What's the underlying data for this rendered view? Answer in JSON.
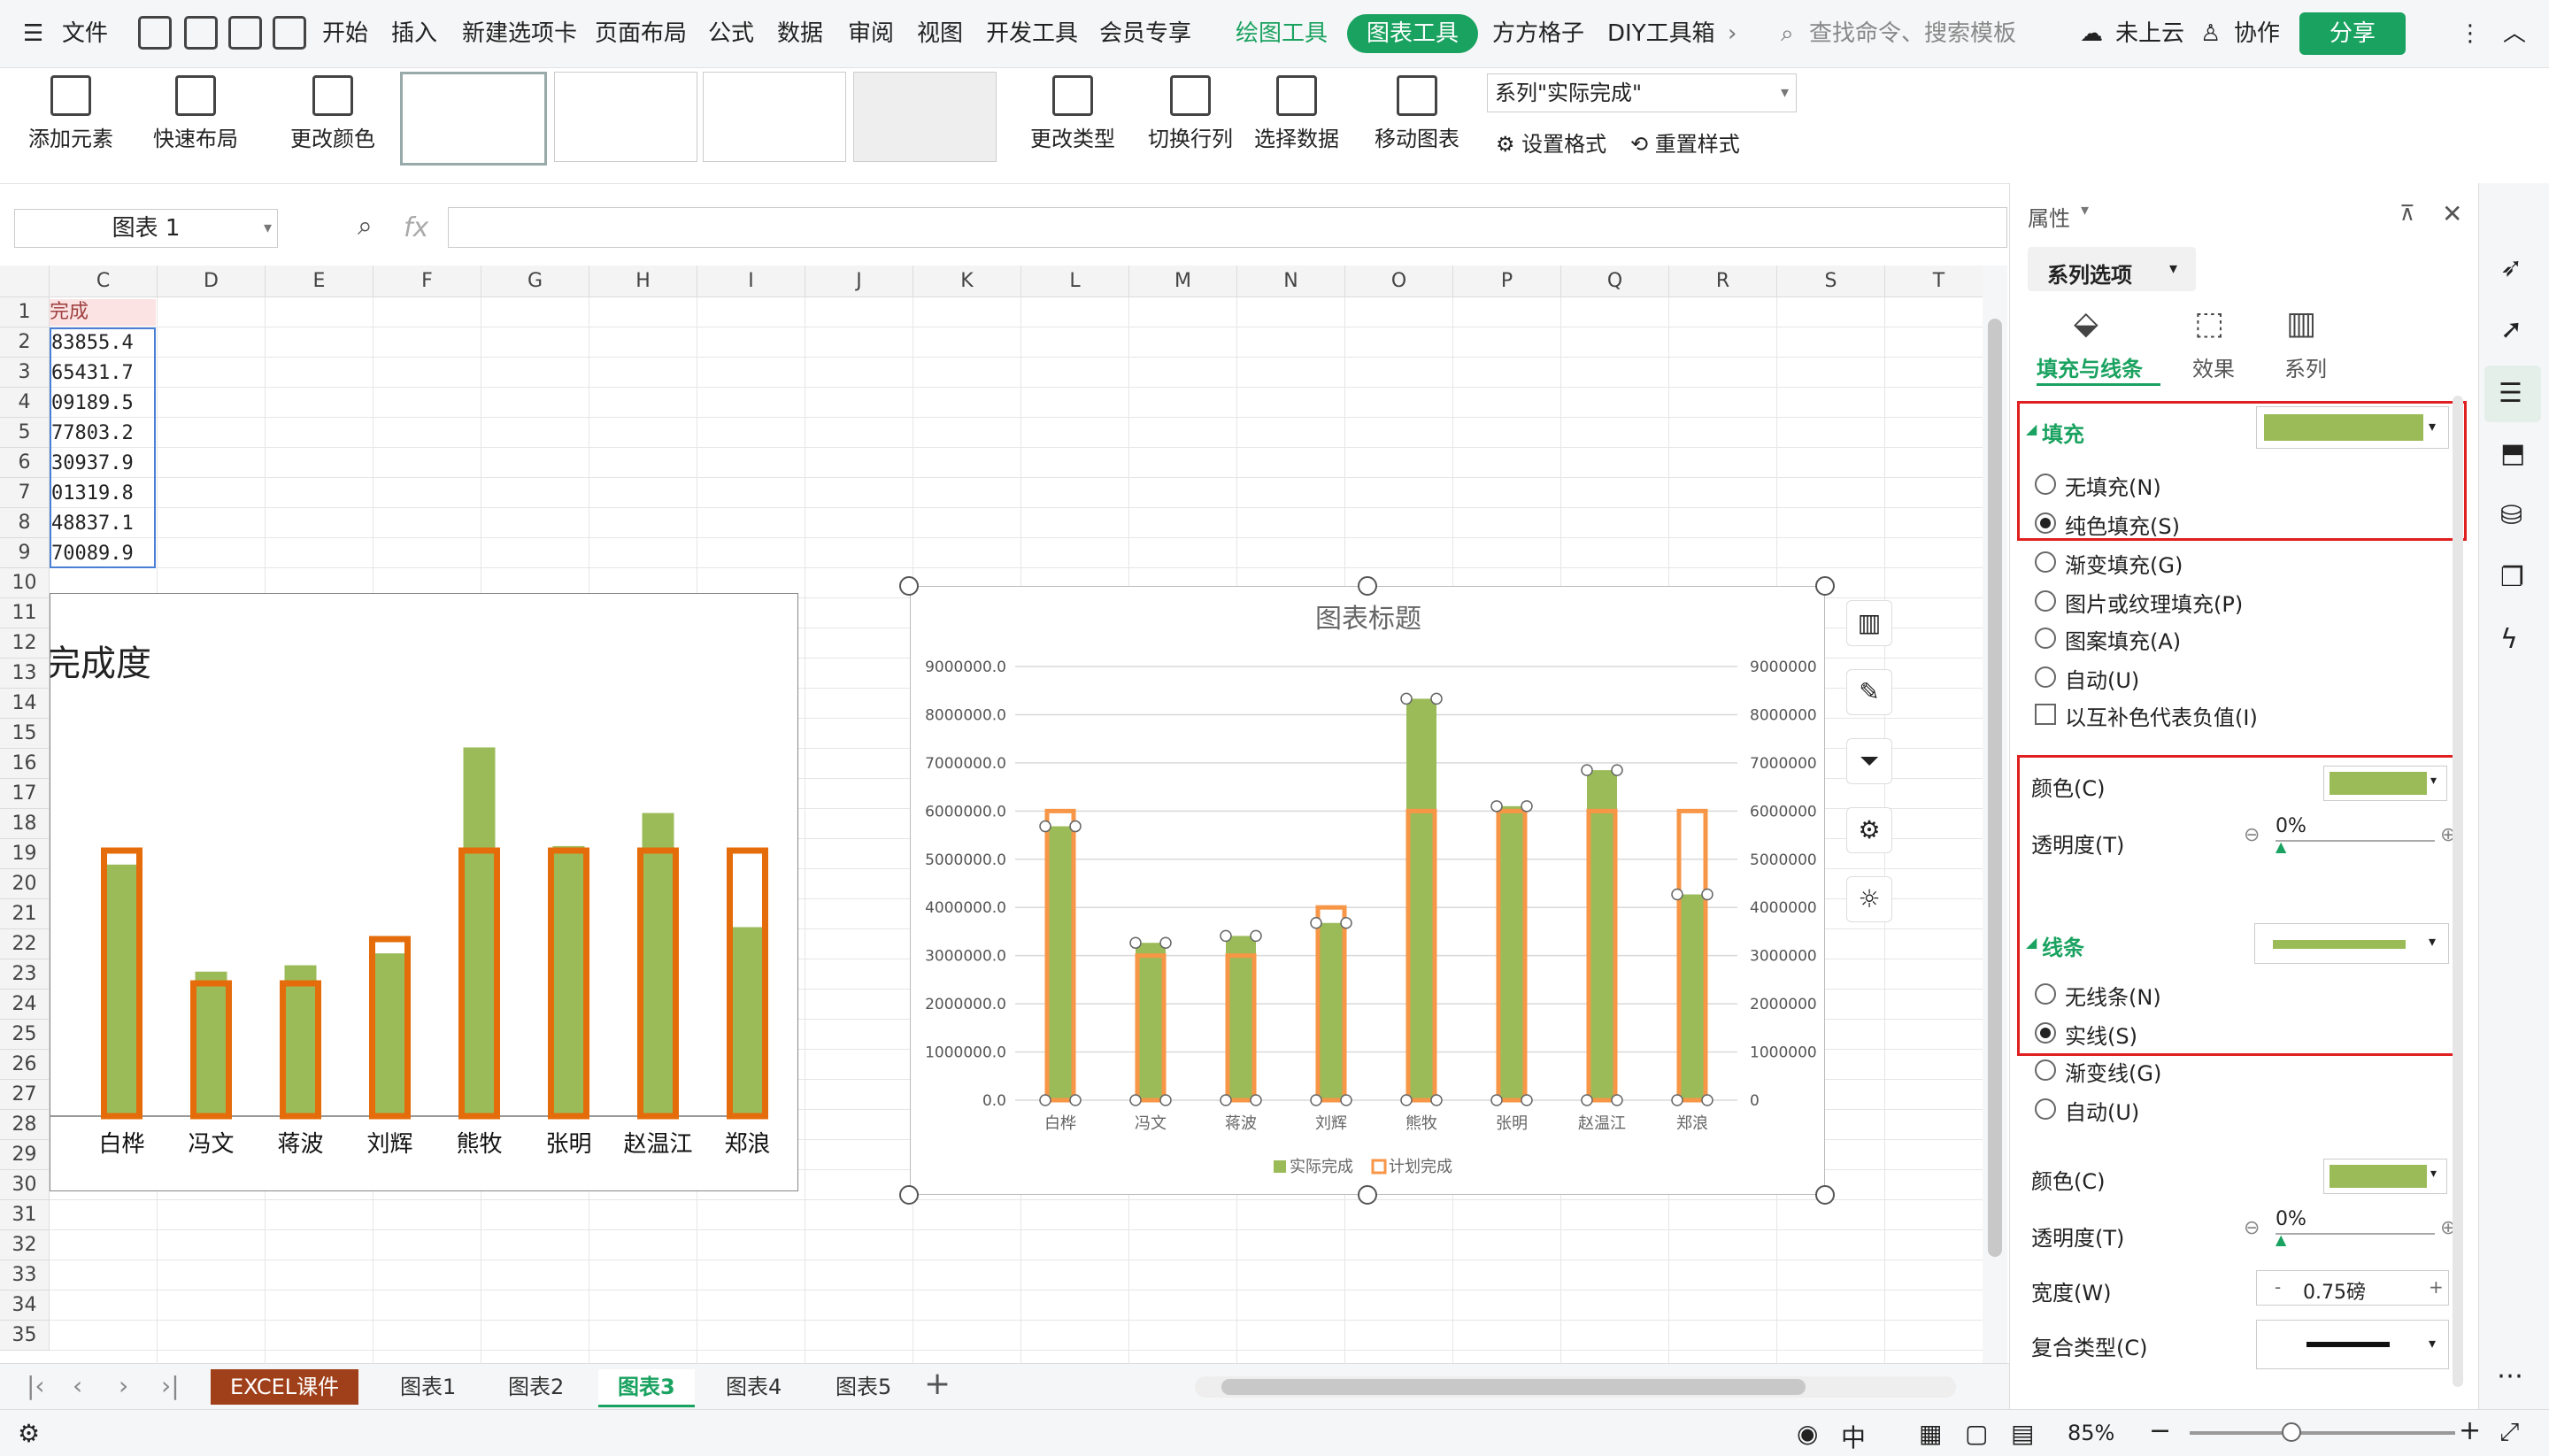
{
  "menu": {
    "file": "文件",
    "items": [
      "开始",
      "插入",
      "新建选项卡",
      "页面布局",
      "公式",
      "数据",
      "审阅",
      "视图",
      "开发工具",
      "会员专享"
    ],
    "draw_tools": "绘图工具",
    "chart_tools": "图表工具",
    "more": [
      "方方格子",
      "DIY工具箱"
    ],
    "search_placeholder": "查找命令、搜索模板",
    "cloud": "未上云",
    "collab": "协作",
    "share": "分享"
  },
  "ribbon": {
    "add_element": "添加元素",
    "quick_layout": "快速布局",
    "change_color": "更改颜色",
    "change_type": "更改类型",
    "switch_row_col": "切换行列",
    "select_data": "选择数据",
    "move_chart": "移动图表",
    "series_select": "系列\"实际完成\"",
    "set_format": "设置格式",
    "reset_style": "重置样式"
  },
  "formula": {
    "name_box": "图表 1",
    "fx": "fx"
  },
  "sheet": {
    "columns": [
      "C",
      "D",
      "E",
      "F",
      "G",
      "H",
      "I",
      "J",
      "K",
      "L",
      "M",
      "N",
      "O",
      "P",
      "Q",
      "R",
      "S",
      "T"
    ],
    "rows": [
      "1",
      "2",
      "3",
      "4",
      "5",
      "6",
      "7",
      "8",
      "9",
      "10",
      "11",
      "12",
      "13",
      "14",
      "15",
      "16",
      "17",
      "18",
      "19",
      "20",
      "21",
      "22",
      "23",
      "24",
      "25",
      "26",
      "27",
      "28",
      "29",
      "30",
      "31",
      "32",
      "33",
      "34",
      "35"
    ],
    "c_header": "完成",
    "c_values": [
      "83855.4",
      "65431.7",
      "09189.5",
      "77803.2",
      "30937.9",
      "01319.8",
      "48837.1",
      "70089.9"
    ]
  },
  "chart1": {
    "title": "完成度",
    "categories": [
      "白桦",
      "冯文",
      "蒋波",
      "刘辉",
      "熊牧",
      "张明",
      "赵温江",
      "郑浪"
    ]
  },
  "chart_data": {
    "type": "bar",
    "title": "图表标题",
    "categories": [
      "白桦",
      "冯文",
      "蒋波",
      "刘辉",
      "熊牧",
      "张明",
      "赵温江",
      "郑浪"
    ],
    "series": [
      {
        "name": "实际完成",
        "values": [
          5683855.4,
          3265431.7,
          3409189.5,
          3677803.2,
          8330937.9,
          6101319.8,
          6848837.1,
          4270089.9
        ],
        "color": "#9bbb59"
      },
      {
        "name": "计划完成",
        "values": [
          6000000,
          3000000,
          3000000,
          4000000,
          6000000,
          6000000,
          6000000,
          6000000
        ],
        "color": "#f79646"
      }
    ],
    "ylim": [
      0,
      9000000
    ],
    "y_ticks": [
      "0.0",
      "1000000.0",
      "2000000.0",
      "3000000.0",
      "4000000.0",
      "5000000.0",
      "6000000.0",
      "7000000.0",
      "8000000.0",
      "9000000.0"
    ],
    "y2_ticks": [
      "0",
      "1000000",
      "2000000",
      "3000000",
      "4000000",
      "5000000",
      "6000000",
      "7000000",
      "8000000",
      "9000000"
    ],
    "grid": true,
    "legend": "bottom"
  },
  "tabs": {
    "items": [
      "EXCEL课件",
      "图表1",
      "图表2",
      "图表3",
      "图表4",
      "图表5"
    ],
    "active": "图表3"
  },
  "panel": {
    "header": "属性",
    "series_options": "系列选项",
    "tabs": [
      "填充与线条",
      "效果",
      "系列"
    ],
    "fill_label": "填充",
    "fill_options": [
      "无填充(N)",
      "纯色填充(S)",
      "渐变填充(G)",
      "图片或纹理填充(P)",
      "图案填充(A)",
      "自动(U)"
    ],
    "invert_neg": "以互补色代表负值(I)",
    "color_label": "颜色(C)",
    "transparency_label": "透明度(T)",
    "transparency_value": "0%",
    "line_label": "线条",
    "line_options": [
      "无线条(N)",
      "实线(S)",
      "渐变线(G)",
      "自动(U)"
    ],
    "color2_label": "颜色(C)",
    "transparency2_label": "透明度(T)",
    "transparency2_value": "0%",
    "width_label": "宽度(W)",
    "width_value": "0.75磅",
    "compound_label": "复合类型(C)",
    "accent": "#9bbb59"
  },
  "status": {
    "zoom": "85%"
  }
}
